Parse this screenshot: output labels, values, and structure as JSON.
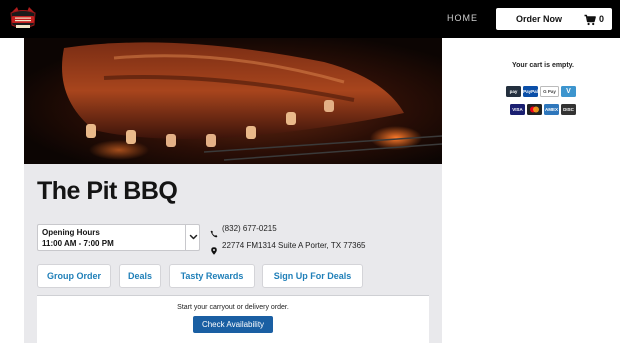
{
  "header": {
    "nav": {
      "home": "HOME"
    },
    "order_button": {
      "label": "Order Now",
      "cart_count": "0"
    }
  },
  "restaurant": {
    "name": "The Pit BBQ",
    "hours": {
      "label": "Opening Hours",
      "value": "11:00 AM - 7:00 PM"
    },
    "phone": "(832) 677-0215",
    "address": "22774 FM1314 Suite A Porter, TX 77365"
  },
  "actions": [
    {
      "label": "Group Order"
    },
    {
      "label": "Deals"
    },
    {
      "label": "Tasty Rewards"
    },
    {
      "label": "Sign Up For Deals"
    }
  ],
  "availability": {
    "prompt": "Start your carryout or delivery order.",
    "button": "Check Availability"
  },
  "cart": {
    "empty_message": "Your cart is empty.",
    "payment_methods": [
      {
        "name": "amazon-pay",
        "text": "pay"
      },
      {
        "name": "paypal",
        "text": "PayPal"
      },
      {
        "name": "google-pay",
        "text": "G Pay"
      },
      {
        "name": "venmo",
        "text": "V"
      },
      {
        "name": "visa",
        "text": "VISA"
      },
      {
        "name": "mastercard",
        "text": ""
      },
      {
        "name": "amex",
        "text": "AMEX"
      },
      {
        "name": "discover",
        "text": "DISC"
      }
    ]
  },
  "colors": {
    "link_blue": "#1f7fb8",
    "button_blue": "#1a5fa3",
    "header_black": "#000000",
    "panel_gray": "#e9e9ec"
  }
}
